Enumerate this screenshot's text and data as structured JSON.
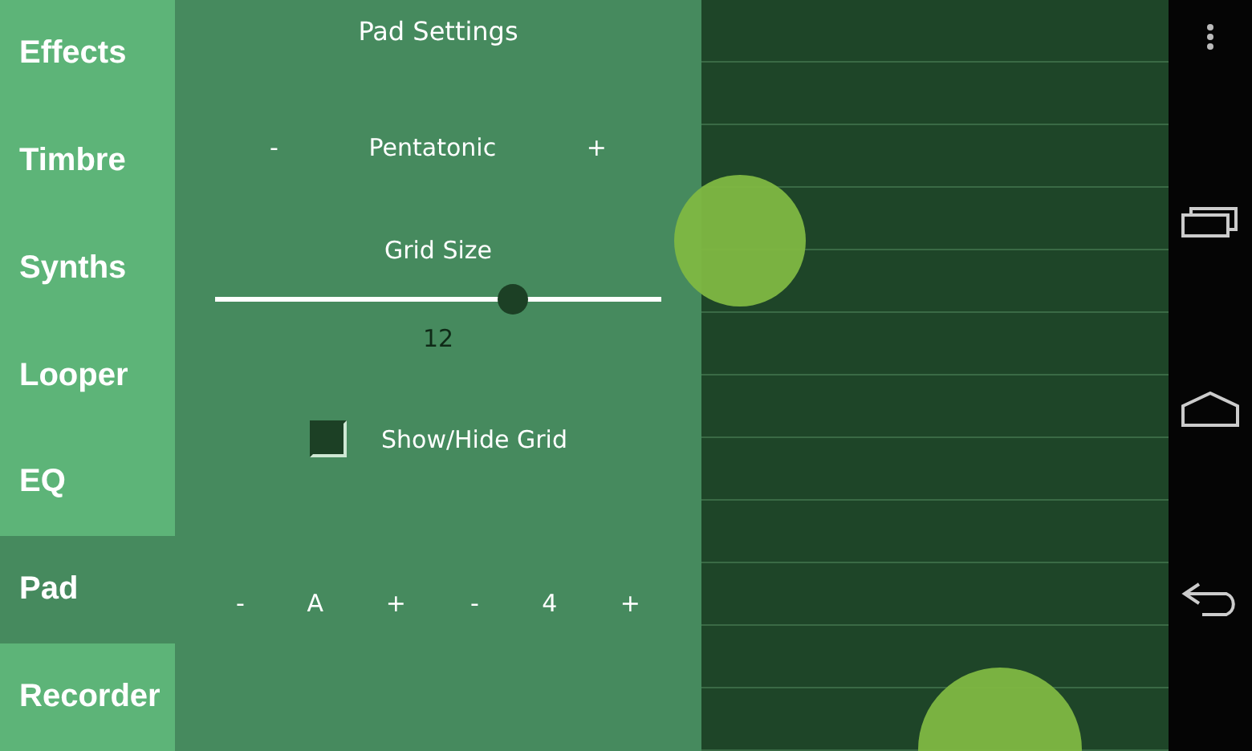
{
  "sidebar": {
    "items": [
      {
        "label": "Effects",
        "selected": false
      },
      {
        "label": "Timbre",
        "selected": false
      },
      {
        "label": "Synths",
        "selected": false
      },
      {
        "label": "Looper",
        "selected": false
      },
      {
        "label": "EQ",
        "selected": false
      },
      {
        "label": "Pad",
        "selected": true
      },
      {
        "label": "Recorder",
        "selected": false
      }
    ]
  },
  "settings": {
    "title": "Pad Settings",
    "scale": {
      "minus": "-",
      "value": "Pentatonic",
      "plus": "+"
    },
    "grid_size": {
      "label": "Grid Size",
      "level": 0.665,
      "value": "12"
    },
    "grid_toggle": {
      "label": "Show/Hide Grid",
      "checked": true
    },
    "key": {
      "minus": "-",
      "value": "A",
      "plus": "+"
    },
    "octave": {
      "minus": "-",
      "value": "4",
      "plus": "+"
    }
  }
}
